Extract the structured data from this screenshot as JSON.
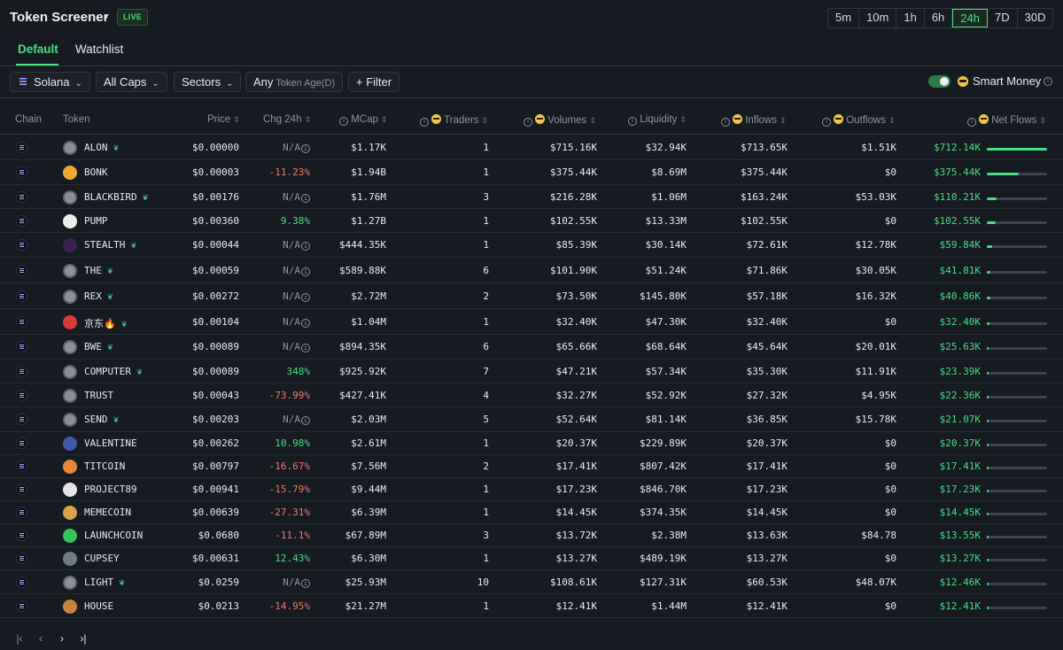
{
  "header": {
    "title": "Token Screener",
    "live_badge": "LIVE",
    "timeframes": [
      "5m",
      "10m",
      "1h",
      "6h",
      "24h",
      "7D",
      "30D"
    ],
    "active_timeframe": "24h"
  },
  "tabs": [
    "Default",
    "Watchlist"
  ],
  "filters": {
    "chain": "Solana",
    "caps": "All Caps",
    "sectors": "Sectors",
    "token_age_value": "Any",
    "token_age_label": "Token Age(D)",
    "filter": "Filter",
    "smart_money": "Smart Money"
  },
  "columns": {
    "chain": "Chain",
    "token": "Token",
    "price": "Price",
    "chg": "Chg 24h",
    "mcap": "MCap",
    "traders": "Traders",
    "volumes": "Volumes",
    "liquidity": "Liquidity",
    "inflows": "Inflows",
    "outflows": "Outflows",
    "netflows": "Net Flows"
  },
  "colors": {
    "accent_green": "#4ade80",
    "negative_red": "#f2786a",
    "background": "#161b22"
  },
  "rows": [
    {
      "token": "ALON",
      "leaf": true,
      "icon_color": "#8a8f98",
      "price": "$0.00000",
      "chg": "N/A",
      "chg_type": "na",
      "mcap": "$1.17K",
      "traders": "1",
      "volumes": "$715.16K",
      "liquidity": "$32.94K",
      "inflows": "$713.65K",
      "outflows": "$1.51K",
      "netflows": "$712.14K",
      "flow_level": 1.0
    },
    {
      "token": "BONK",
      "leaf": false,
      "icon_color": "#f0a632",
      "price": "$0.00003",
      "chg": "-11.23%",
      "chg_type": "neg",
      "mcap": "$1.94B",
      "traders": "1",
      "volumes": "$375.44K",
      "liquidity": "$8.69M",
      "inflows": "$375.44K",
      "outflows": "$0",
      "netflows": "$375.44K",
      "flow_level": 0.53
    },
    {
      "token": "BLACKBIRD",
      "leaf": true,
      "icon_color": "#8a8f98",
      "price": "$0.00176",
      "chg": "N/A",
      "chg_type": "na",
      "mcap": "$1.76M",
      "traders": "3",
      "volumes": "$216.28K",
      "liquidity": "$1.06M",
      "inflows": "$163.24K",
      "outflows": "$53.03K",
      "netflows": "$110.21K",
      "flow_level": 0.155
    },
    {
      "token": "PUMP",
      "leaf": false,
      "icon_color": "#e8f2ea",
      "price": "$0.00360",
      "chg": "9.38%",
      "chg_type": "pos",
      "mcap": "$1.27B",
      "traders": "1",
      "volumes": "$102.55K",
      "liquidity": "$13.33M",
      "inflows": "$102.55K",
      "outflows": "$0",
      "netflows": "$102.55K",
      "flow_level": 0.144
    },
    {
      "token": "STEALTH",
      "leaf": true,
      "icon_color": "#3a2350",
      "price": "$0.00044",
      "chg": "N/A",
      "chg_type": "na",
      "mcap": "$444.35K",
      "traders": "1",
      "volumes": "$85.39K",
      "liquidity": "$30.14K",
      "inflows": "$72.61K",
      "outflows": "$12.78K",
      "netflows": "$59.84K",
      "flow_level": 0.084
    },
    {
      "token": "THE",
      "leaf": true,
      "icon_color": "#8a8f98",
      "price": "$0.00059",
      "chg": "N/A",
      "chg_type": "na",
      "mcap": "$589.88K",
      "traders": "6",
      "volumes": "$101.90K",
      "liquidity": "$51.24K",
      "inflows": "$71.86K",
      "outflows": "$30.05K",
      "netflows": "$41.81K",
      "flow_level": 0.059
    },
    {
      "token": "REX",
      "leaf": true,
      "icon_color": "#8a8f98",
      "price": "$0.00272",
      "chg": "N/A",
      "chg_type": "na",
      "mcap": "$2.72M",
      "traders": "2",
      "volumes": "$73.50K",
      "liquidity": "$145.80K",
      "inflows": "$57.18K",
      "outflows": "$16.32K",
      "netflows": "$40.86K",
      "flow_level": 0.057
    },
    {
      "token": "京东🔥",
      "leaf": true,
      "icon_color": "#d63b35",
      "price": "$0.00104",
      "chg": "N/A",
      "chg_type": "na",
      "mcap": "$1.04M",
      "traders": "1",
      "volumes": "$32.40K",
      "liquidity": "$47.30K",
      "inflows": "$32.40K",
      "outflows": "$0",
      "netflows": "$32.40K",
      "flow_level": 0.045
    },
    {
      "token": "BWE",
      "leaf": true,
      "icon_color": "#8a8f98",
      "price": "$0.00089",
      "chg": "N/A",
      "chg_type": "na",
      "mcap": "$894.35K",
      "traders": "6",
      "volumes": "$65.66K",
      "liquidity": "$68.64K",
      "inflows": "$45.64K",
      "outflows": "$20.01K",
      "netflows": "$25.63K",
      "flow_level": 0.036
    },
    {
      "token": "COMPUTER",
      "leaf": true,
      "icon_color": "#8a8f98",
      "price": "$0.00089",
      "chg": "348%",
      "chg_type": "pos",
      "mcap": "$925.92K",
      "traders": "7",
      "volumes": "$47.21K",
      "liquidity": "$57.34K",
      "inflows": "$35.30K",
      "outflows": "$11.91K",
      "netflows": "$23.39K",
      "flow_level": 0.033
    },
    {
      "token": "TRUST",
      "leaf": false,
      "icon_color": "#8a8f98",
      "price": "$0.00043",
      "chg": "-73.99%",
      "chg_type": "neg",
      "mcap": "$427.41K",
      "traders": "4",
      "volumes": "$32.27K",
      "liquidity": "$52.92K",
      "inflows": "$27.32K",
      "outflows": "$4.95K",
      "netflows": "$22.36K",
      "flow_level": 0.031
    },
    {
      "token": "SEND",
      "leaf": true,
      "icon_color": "#8a8f98",
      "price": "$0.00203",
      "chg": "N/A",
      "chg_type": "na",
      "mcap": "$2.03M",
      "traders": "5",
      "volumes": "$52.64K",
      "liquidity": "$81.14K",
      "inflows": "$36.85K",
      "outflows": "$15.78K",
      "netflows": "$21.07K",
      "flow_level": 0.03
    },
    {
      "token": "VALENTINE",
      "leaf": false,
      "icon_color": "#3f5aa8",
      "price": "$0.00262",
      "chg": "10.98%",
      "chg_type": "pos",
      "mcap": "$2.61M",
      "traders": "1",
      "volumes": "$20.37K",
      "liquidity": "$229.89K",
      "inflows": "$20.37K",
      "outflows": "$0",
      "netflows": "$20.37K",
      "flow_level": 0.029
    },
    {
      "token": "TITCOIN",
      "leaf": false,
      "icon_color": "#e8843c",
      "price": "$0.00797",
      "chg": "-16.67%",
      "chg_type": "neg",
      "mcap": "$7.56M",
      "traders": "2",
      "volumes": "$17.41K",
      "liquidity": "$807.42K",
      "inflows": "$17.41K",
      "outflows": "$0",
      "netflows": "$17.41K",
      "flow_level": 0.024
    },
    {
      "token": "PROJECT89",
      "leaf": false,
      "icon_color": "#e4e4e4",
      "price": "$0.00941",
      "chg": "-15.79%",
      "chg_type": "neg",
      "mcap": "$9.44M",
      "traders": "1",
      "volumes": "$17.23K",
      "liquidity": "$846.70K",
      "inflows": "$17.23K",
      "outflows": "$0",
      "netflows": "$17.23K",
      "flow_level": 0.024
    },
    {
      "token": "MEMECOIN",
      "leaf": false,
      "icon_color": "#d9a24a",
      "price": "$0.00639",
      "chg": "-27.31%",
      "chg_type": "neg",
      "mcap": "$6.39M",
      "traders": "1",
      "volumes": "$14.45K",
      "liquidity": "$374.35K",
      "inflows": "$14.45K",
      "outflows": "$0",
      "netflows": "$14.45K",
      "flow_level": 0.02
    },
    {
      "token": "LAUNCHCOIN",
      "leaf": false,
      "icon_color": "#37c25a",
      "price": "$0.0680",
      "chg": "-11.1%",
      "chg_type": "neg",
      "mcap": "$67.89M",
      "traders": "3",
      "volumes": "$13.72K",
      "liquidity": "$2.38M",
      "inflows": "$13.63K",
      "outflows": "$84.78",
      "netflows": "$13.55K",
      "flow_level": 0.019
    },
    {
      "token": "CUPSEY",
      "leaf": false,
      "icon_color": "#6f7c86",
      "price": "$0.00631",
      "chg": "12.43%",
      "chg_type": "pos",
      "mcap": "$6.30M",
      "traders": "1",
      "volumes": "$13.27K",
      "liquidity": "$489.19K",
      "inflows": "$13.27K",
      "outflows": "$0",
      "netflows": "$13.27K",
      "flow_level": 0.019
    },
    {
      "token": "LIGHT",
      "leaf": true,
      "icon_color": "#8a8f98",
      "price": "$0.0259",
      "chg": "N/A",
      "chg_type": "na",
      "mcap": "$25.93M",
      "traders": "10",
      "volumes": "$108.61K",
      "liquidity": "$127.31K",
      "inflows": "$60.53K",
      "outflows": "$48.07K",
      "netflows": "$12.46K",
      "flow_level": 0.017
    },
    {
      "token": "HOUSE",
      "leaf": false,
      "icon_color": "#c8843a",
      "price": "$0.0213",
      "chg": "-14.95%",
      "chg_type": "neg",
      "mcap": "$21.27M",
      "traders": "1",
      "volumes": "$12.41K",
      "liquidity": "$1.44M",
      "inflows": "$12.41K",
      "outflows": "$0",
      "netflows": "$12.41K",
      "flow_level": 0.017
    }
  ],
  "pager": {
    "first_icon": "first-page-icon",
    "prev_icon": "prev-page-icon",
    "next_icon": "next-page-icon",
    "last_icon": "last-page-icon"
  }
}
